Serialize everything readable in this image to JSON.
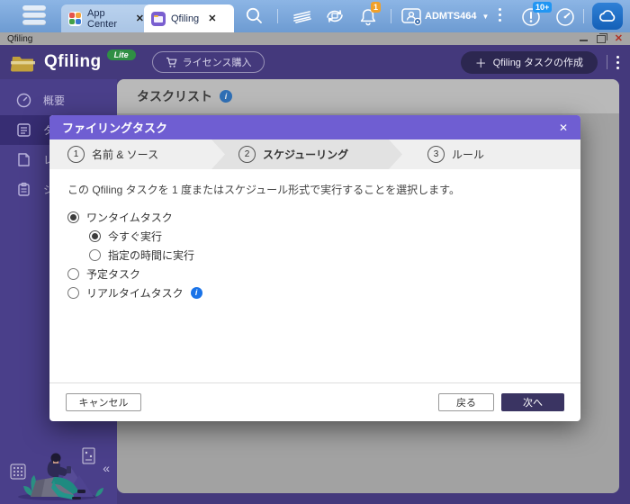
{
  "glyphs": {
    "close": "✕",
    "collapse": "«",
    "caret": "▼",
    "plus": "＋",
    "info": "i"
  },
  "taskbar": {
    "tabs": [
      {
        "label": "App Center"
      },
      {
        "label": "Qfiling"
      }
    ],
    "username": "ADMTS464",
    "bell_badge": "1",
    "monitor_badge": "10+"
  },
  "window": {
    "title": "Qfiling"
  },
  "app_header": {
    "name": "Qfiling",
    "edition_badge": "Lite",
    "license_button": "ライセンス購入",
    "create_task_button": "Qfiling タスクの作成"
  },
  "sidebar": {
    "items": [
      {
        "label": "概要"
      },
      {
        "label": "タ"
      },
      {
        "label": "レ"
      },
      {
        "label": "シ"
      }
    ]
  },
  "content": {
    "title": "タスクリスト"
  },
  "modal": {
    "title": "ファイリングタスク",
    "steps": [
      {
        "num": "1",
        "label": "名前 & ソース",
        "active": false
      },
      {
        "num": "2",
        "label": "スケジューリング",
        "active": true
      },
      {
        "num": "3",
        "label": "ルール",
        "active": false
      }
    ],
    "description": "この Qfiling タスクを 1 度またはスケジュール形式で実行することを選択します。",
    "options": [
      {
        "label": "ワンタイムタスク",
        "selected": true,
        "indent": 0
      },
      {
        "label": "今すぐ実行",
        "selected": true,
        "indent": 1
      },
      {
        "label": "指定の時間に実行",
        "selected": false,
        "indent": 1
      },
      {
        "label": "予定タスク",
        "selected": false,
        "indent": 0
      },
      {
        "label": "リアルタイムタスク",
        "selected": false,
        "indent": 0,
        "has_info": true
      }
    ],
    "cancel_button": "キャンセル",
    "back_button": "戻る",
    "next_button": "次へ"
  },
  "colors": {
    "modal_header": "#6f5ed2",
    "app_header": "#44397c",
    "sidebar": "#4a3f8a",
    "accent_dark_button": "#3a3462",
    "info_blue": "#1a73e8",
    "lite_green": "#2f8f44",
    "bell_badge_orange": "#f0a02a",
    "monitor_badge_blue": "#2196f3"
  }
}
